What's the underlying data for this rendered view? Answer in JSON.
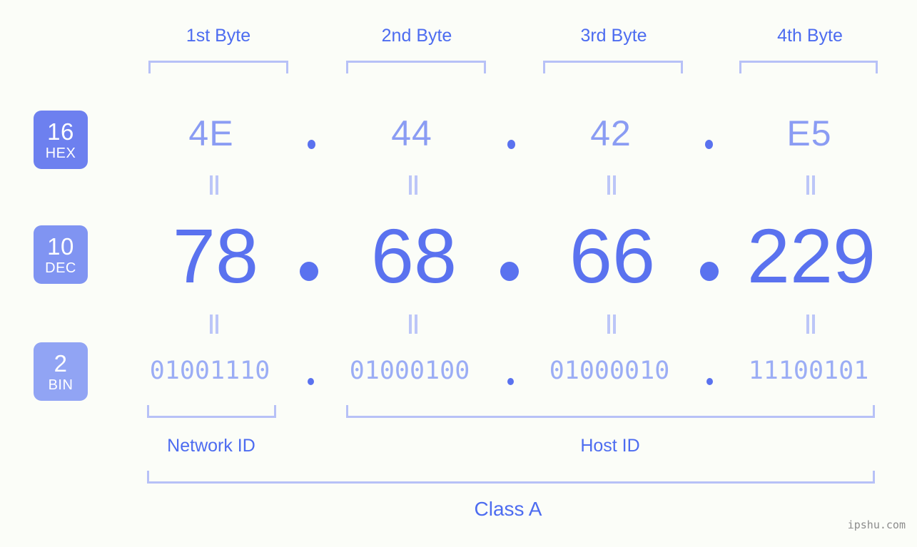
{
  "background_color": "#fbfdf8",
  "accent_color": "#5a72ef",
  "bracket_color": "#b7c1f7",
  "byte_headers": [
    {
      "label": "1st Byte"
    },
    {
      "label": "2nd Byte"
    },
    {
      "label": "3rd Byte"
    },
    {
      "label": "4th Byte"
    }
  ],
  "bases": [
    {
      "num": "16",
      "abbr": "HEX",
      "color": "#6d80ef"
    },
    {
      "num": "10",
      "abbr": "DEC",
      "color": "#8094f2"
    },
    {
      "num": "2",
      "abbr": "BIN",
      "color": "#91a4f4"
    }
  ],
  "rows": {
    "hex": {
      "values": [
        "4E",
        "44",
        "42",
        "E5"
      ],
      "separator": "."
    },
    "dec": {
      "values": [
        "78",
        "68",
        "66",
        "229"
      ],
      "separator": "."
    },
    "bin": {
      "values": [
        "01001110",
        "01000100",
        "01000010",
        "11100101"
      ],
      "separator": "."
    }
  },
  "equality_symbol": "‖",
  "segments": {
    "network_id": "Network ID",
    "host_id": "Host ID",
    "class": "Class A"
  },
  "watermark": "ipshu.com"
}
